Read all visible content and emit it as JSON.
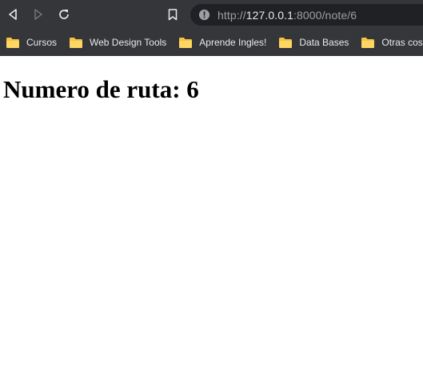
{
  "browser": {
    "url_scheme": "http://",
    "url_host": "127.0.0.1",
    "url_port_path": ":8000/note/6",
    "bookmarks": [
      {
        "label": "Cursos",
        "icon": "folder-icon"
      },
      {
        "label": "Web Design Tools",
        "icon": "folder-icon"
      },
      {
        "label": "Aprende Ingles!",
        "icon": "folder-icon"
      },
      {
        "label": "Data Bases",
        "icon": "folder-icon"
      },
      {
        "label": "Otras cosas",
        "icon": "folder-icon"
      }
    ],
    "colors": {
      "chrome": "#35363a",
      "omnibox": "#202124",
      "folder": "#f6c343"
    }
  },
  "page": {
    "heading": "Numero de ruta: 6"
  }
}
